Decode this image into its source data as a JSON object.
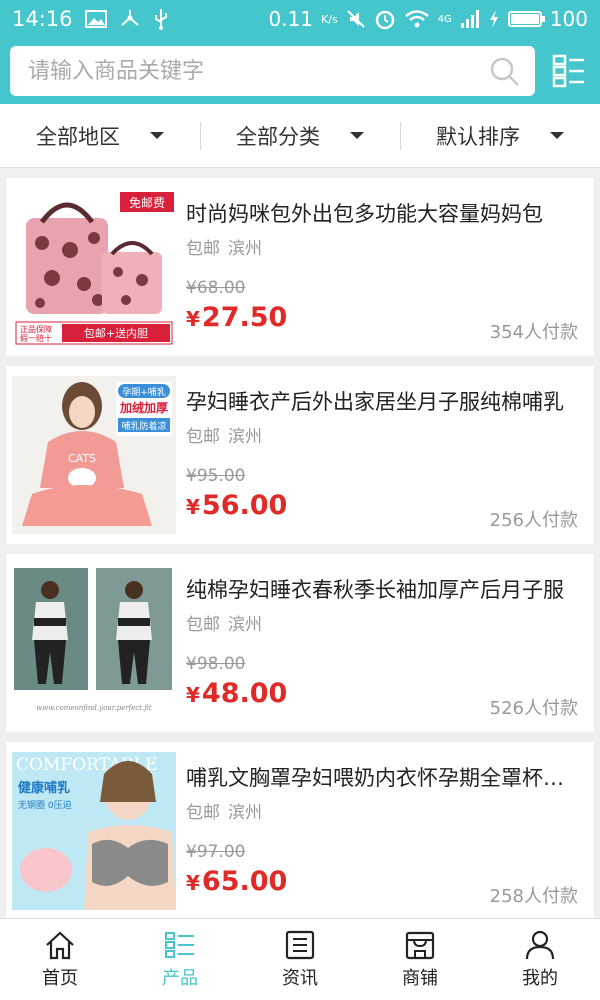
{
  "status_bar": {
    "time": "14:16",
    "speed": "0.11",
    "speed_unit": "K/s",
    "net": "4G",
    "battery": "100",
    "battery_level": 1.0
  },
  "search": {
    "placeholder": "请输入商品关键字"
  },
  "filters": [
    {
      "label": "全部地区"
    },
    {
      "label": "全部分类"
    },
    {
      "label": "默认排序"
    }
  ],
  "products": [
    {
      "title": "时尚妈咪包外出包多功能大容量妈妈包",
      "shipping": "包邮",
      "location": "滨州",
      "original_price": "¥68.00",
      "currency": "¥",
      "price": "27.50",
      "sales": "354人付款",
      "image_text": {
        "badge": "免邮费",
        "footer_left": "正品保障",
        "footer_left2": "假一赔十",
        "footer_right": "包邮+送内胆"
      }
    },
    {
      "title": "孕妇睡衣产后外出家居坐月子服纯棉哺乳",
      "shipping": "包邮",
      "location": "滨州",
      "original_price": "¥95.00",
      "currency": "¥",
      "price": "56.00",
      "sales": "256人付款",
      "image_text": {
        "badge1": "孕期+哺乳",
        "badge2": "加绒加厚",
        "badge3": "哺乳防着凉",
        "shirt": "CATS"
      }
    },
    {
      "title": "纯棉孕妇睡衣春秋季长袖加厚产后月子服",
      "shipping": "包邮",
      "location": "滨州",
      "original_price": "¥98.00",
      "currency": "¥",
      "price": "48.00",
      "sales": "526人付款",
      "image_text": {
        "caption": "www.comeonfind.your.perfect.fit"
      }
    },
    {
      "title": "哺乳文胸罩孕妇喂奶内衣怀孕期全罩杯聚拢",
      "shipping": "包邮",
      "location": "滨州",
      "original_price": "¥97.00",
      "currency": "¥",
      "price": "65.00",
      "sales": "258人付款",
      "image_text": {
        "banner": "COMFORTABLE",
        "line1": "健康哺乳",
        "line2": "无钢圈 0压迫"
      }
    }
  ],
  "tabbar": [
    {
      "label": "首页",
      "icon": "home-icon",
      "active": false
    },
    {
      "label": "产品",
      "icon": "products-icon",
      "active": true
    },
    {
      "label": "资讯",
      "icon": "news-icon",
      "active": false
    },
    {
      "label": "商铺",
      "icon": "shop-icon",
      "active": false
    },
    {
      "label": "我的",
      "icon": "profile-icon",
      "active": false
    }
  ],
  "colors": {
    "primary": "#45c6cc",
    "price": "#e02a28",
    "muted": "#999999"
  }
}
